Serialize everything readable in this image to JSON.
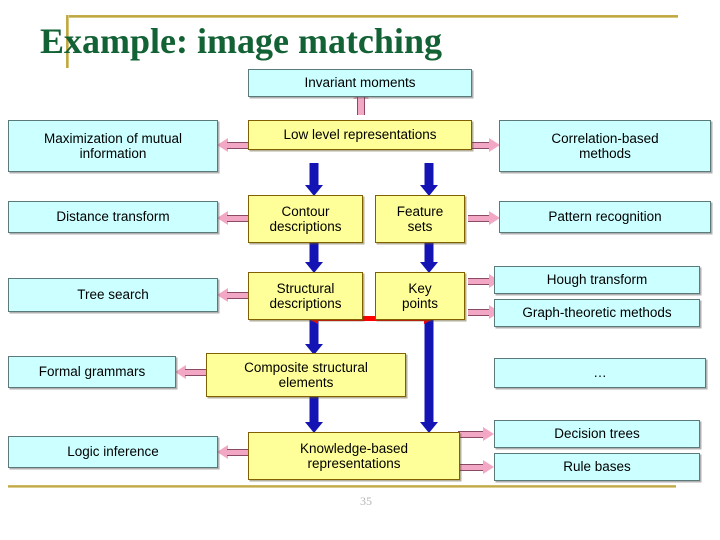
{
  "slide": {
    "title": "Example: image matching",
    "page_number": "35",
    "accent_gold": "#b9a03c",
    "title_color": "#136235",
    "cyan_fill": "#ccffff",
    "yellow_fill": "#ffff99",
    "blue_arrow": "#1414b4",
    "pink_arrow": "#f2a8c4",
    "red_arrow": "#ff0000"
  },
  "diagram": {
    "center_column": [
      {
        "id": "invariant-moments",
        "label": "Invariant moments",
        "fill": "cyan"
      },
      {
        "id": "low-level-representations",
        "label": "Low level representations",
        "fill": "yellow"
      },
      {
        "id": "contour-descriptions",
        "label_line1": "Contour",
        "label_line2": "descriptions",
        "fill": "yellow"
      },
      {
        "id": "feature-sets",
        "label_line1": "Feature",
        "label_line2": "sets",
        "fill": "yellow"
      },
      {
        "id": "structural-descriptions",
        "label_line1": "Structural",
        "label_line2": "descriptions",
        "fill": "yellow"
      },
      {
        "id": "key-points",
        "label_line1": "Key",
        "label_line2": "points",
        "fill": "yellow"
      },
      {
        "id": "composite-structural-elements",
        "label_line1": "Composite structural",
        "label_line2": "elements",
        "fill": "yellow"
      },
      {
        "id": "knowledge-based-representations",
        "label_line1": "Knowledge-based",
        "label_line2": "representations",
        "fill": "yellow"
      }
    ],
    "left_column": [
      {
        "id": "maximization-of-mutual-information",
        "label_line1": "Maximization of mutual",
        "label_line2": "information"
      },
      {
        "id": "distance-transform",
        "label": "Distance transform"
      },
      {
        "id": "tree-search",
        "label": "Tree search"
      },
      {
        "id": "formal-grammars",
        "label": "Formal grammars"
      },
      {
        "id": "logic-inference",
        "label": "Logic inference"
      }
    ],
    "right_column": [
      {
        "id": "correlation-based-methods",
        "label_line1": "Correlation-based",
        "label_line2": "methods"
      },
      {
        "id": "pattern-recognition",
        "label": "Pattern recognition"
      },
      {
        "id": "hough-transform",
        "label": "Hough transform"
      },
      {
        "id": "graph-theoretic-methods",
        "label": "Graph-theoretic methods"
      },
      {
        "id": "ellipsis",
        "label": "…"
      },
      {
        "id": "decision-trees",
        "label": "Decision trees"
      },
      {
        "id": "rule-bases",
        "label": "Rule bases"
      }
    ]
  }
}
